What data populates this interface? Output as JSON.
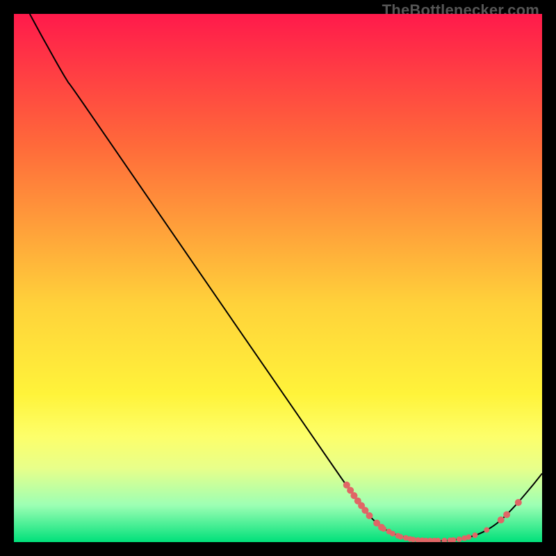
{
  "attribution": "TheBottlenecker.com",
  "chart_data": {
    "type": "line",
    "title": "",
    "xlabel": "",
    "ylabel": "",
    "xlim": [
      0,
      100
    ],
    "ylim": [
      0,
      100
    ],
    "gradient_stops": [
      {
        "offset": 0,
        "color": "#ff1a4b"
      },
      {
        "offset": 25,
        "color": "#ff6a3a"
      },
      {
        "offset": 55,
        "color": "#ffd23a"
      },
      {
        "offset": 72,
        "color": "#fff33a"
      },
      {
        "offset": 80,
        "color": "#fdff6a"
      },
      {
        "offset": 86,
        "color": "#e8ff8a"
      },
      {
        "offset": 93,
        "color": "#9dffb4"
      },
      {
        "offset": 100,
        "color": "#00e07a"
      }
    ],
    "series": [
      {
        "name": "bottleneck-curve",
        "points": [
          {
            "x": 3.0,
            "y": 100.0
          },
          {
            "x": 6.0,
            "y": 94.5
          },
          {
            "x": 10.0,
            "y": 87.5
          },
          {
            "x": 13.5,
            "y": 82.5
          },
          {
            "x": 40.0,
            "y": 44.0
          },
          {
            "x": 60.0,
            "y": 15.0
          },
          {
            "x": 63.5,
            "y": 10.0
          },
          {
            "x": 66.0,
            "y": 6.5
          },
          {
            "x": 68.5,
            "y": 3.8
          },
          {
            "x": 71.0,
            "y": 2.0
          },
          {
            "x": 74.0,
            "y": 0.9
          },
          {
            "x": 78.0,
            "y": 0.3
          },
          {
            "x": 82.0,
            "y": 0.3
          },
          {
            "x": 86.0,
            "y": 0.9
          },
          {
            "x": 89.0,
            "y": 2.0
          },
          {
            "x": 92.0,
            "y": 4.0
          },
          {
            "x": 95.0,
            "y": 7.0
          },
          {
            "x": 98.0,
            "y": 10.5
          },
          {
            "x": 100.0,
            "y": 13.0
          }
        ]
      }
    ],
    "markers": [
      {
        "x": 63.0,
        "y": 10.8,
        "r": 5
      },
      {
        "x": 63.7,
        "y": 9.8,
        "r": 5
      },
      {
        "x": 64.4,
        "y": 8.8,
        "r": 5
      },
      {
        "x": 65.1,
        "y": 7.8,
        "r": 5
      },
      {
        "x": 65.8,
        "y": 6.9,
        "r": 5
      },
      {
        "x": 66.5,
        "y": 6.0,
        "r": 5
      },
      {
        "x": 67.3,
        "y": 5.0,
        "r": 5
      },
      {
        "x": 68.7,
        "y": 3.6,
        "r": 5
      },
      {
        "x": 69.6,
        "y": 2.8,
        "r": 5
      },
      {
        "x": 70.0,
        "y": 2.5,
        "r": 4
      },
      {
        "x": 71.0,
        "y": 2.0,
        "r": 4
      },
      {
        "x": 71.7,
        "y": 1.6,
        "r": 4
      },
      {
        "x": 72.7,
        "y": 1.2,
        "r": 4
      },
      {
        "x": 73.2,
        "y": 1.0,
        "r": 4
      },
      {
        "x": 74.2,
        "y": 0.8,
        "r": 4
      },
      {
        "x": 75.0,
        "y": 0.6,
        "r": 4
      },
      {
        "x": 75.6,
        "y": 0.5,
        "r": 4
      },
      {
        "x": 76.5,
        "y": 0.4,
        "r": 4
      },
      {
        "x": 77.3,
        "y": 0.35,
        "r": 4
      },
      {
        "x": 78.0,
        "y": 0.3,
        "r": 4
      },
      {
        "x": 78.8,
        "y": 0.3,
        "r": 4
      },
      {
        "x": 79.6,
        "y": 0.3,
        "r": 4
      },
      {
        "x": 80.3,
        "y": 0.3,
        "r": 4
      },
      {
        "x": 81.5,
        "y": 0.3,
        "r": 4
      },
      {
        "x": 82.6,
        "y": 0.35,
        "r": 4
      },
      {
        "x": 83.2,
        "y": 0.4,
        "r": 4
      },
      {
        "x": 84.3,
        "y": 0.55,
        "r": 4
      },
      {
        "x": 85.3,
        "y": 0.75,
        "r": 4
      },
      {
        "x": 86.1,
        "y": 0.95,
        "r": 4
      },
      {
        "x": 87.3,
        "y": 1.3,
        "r": 4
      },
      {
        "x": 89.5,
        "y": 2.3,
        "r": 4
      },
      {
        "x": 92.2,
        "y": 4.2,
        "r": 5
      },
      {
        "x": 93.3,
        "y": 5.2,
        "r": 5
      },
      {
        "x": 95.5,
        "y": 7.5,
        "r": 5
      }
    ],
    "marker_color": "#e06666",
    "line_color": "#000000"
  }
}
